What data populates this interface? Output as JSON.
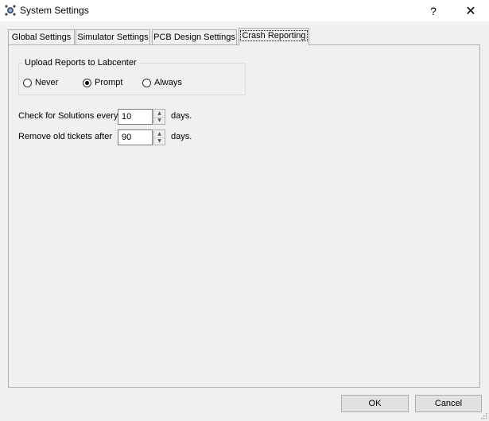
{
  "window": {
    "title": "System Settings",
    "help_label": "?",
    "close_label": "✕"
  },
  "tabs": [
    {
      "label": "Global Settings",
      "active": false
    },
    {
      "label": "Simulator Settings",
      "active": false
    },
    {
      "label": "PCB Design Settings",
      "active": false
    },
    {
      "label": "Crash Reporting",
      "active": true
    }
  ],
  "upload_group": {
    "title": "Upload Reports to Labcenter",
    "options": [
      {
        "label": "Never",
        "checked": false
      },
      {
        "label": "Prompt",
        "checked": true
      },
      {
        "label": "Always",
        "checked": false
      }
    ]
  },
  "check_solutions": {
    "label": "Check for Solutions every",
    "value": "10",
    "unit": "days."
  },
  "remove_tickets": {
    "label": "Remove old tickets after",
    "value": "90",
    "unit": "days."
  },
  "buttons": {
    "ok_label": "OK",
    "cancel_label": "Cancel"
  }
}
